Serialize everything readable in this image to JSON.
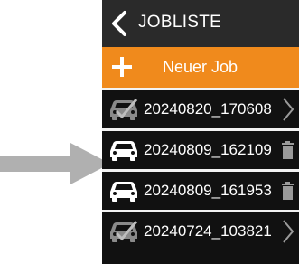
{
  "header": {
    "title": "JOBLISTE",
    "back_icon": "chevron-left-icon"
  },
  "new_job": {
    "label": "Neuer Job",
    "icon": "plus-icon"
  },
  "jobs": [
    {
      "name": "20240820_170608",
      "icon": "car-checked-icon",
      "action_icon": "chevron-right-icon"
    },
    {
      "name": "20240809_162109",
      "icon": "car-icon",
      "action_icon": "trash-icon"
    },
    {
      "name": "20240809_161953",
      "icon": "car-icon",
      "action_icon": "trash-icon"
    },
    {
      "name": "20240724_103821",
      "icon": "car-checked-icon",
      "action_icon": "chevron-right-icon"
    }
  ],
  "annotation": {
    "icon": "pointer-arrow-icon",
    "color": "#b0b0b0"
  },
  "colors": {
    "accent": "#f08a1c",
    "panel": "#111111",
    "header": "#2a2a2a",
    "text": "#ffffff",
    "muted_icon": "#9a9a9a"
  }
}
